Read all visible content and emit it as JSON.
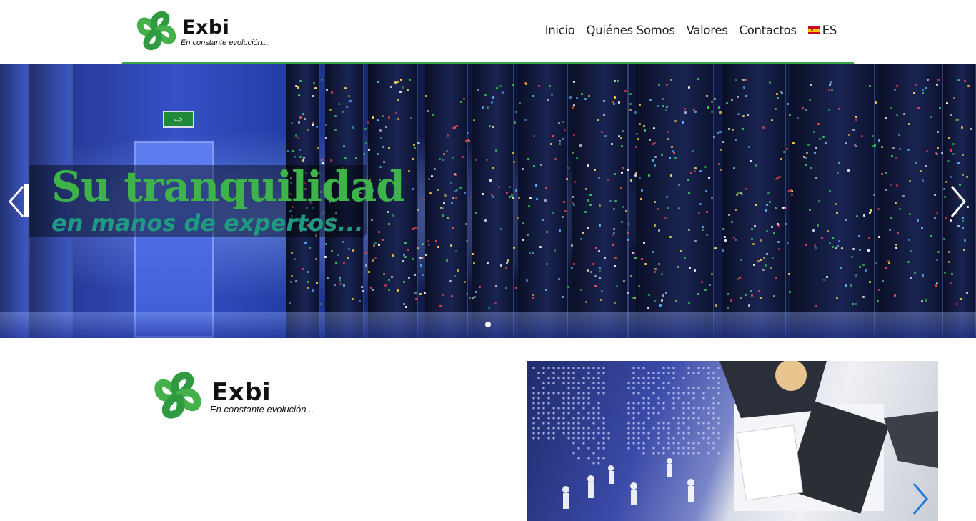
{
  "header": {
    "logo": {
      "name": "Exbi",
      "tagline": "En constante evolución..."
    },
    "nav": [
      {
        "label": "Inicio"
      },
      {
        "label": "Quiénes Somos"
      },
      {
        "label": "Valores"
      },
      {
        "label": "Contactos"
      }
    ],
    "language": {
      "label": "ES",
      "flag": "spain-flag-icon"
    }
  },
  "hero": {
    "title": "Su tranquilidad",
    "subtitle": "en manos de expertos...",
    "active_slide": 1,
    "colors": {
      "title": "#3db34a",
      "subtitle": "#1f9a80"
    }
  },
  "about": {
    "logo": {
      "name": "Exbi",
      "tagline": "En constante evolución..."
    }
  },
  "colors": {
    "accent": "#3aa84a",
    "arrow_blue": "#1e7bd8"
  }
}
